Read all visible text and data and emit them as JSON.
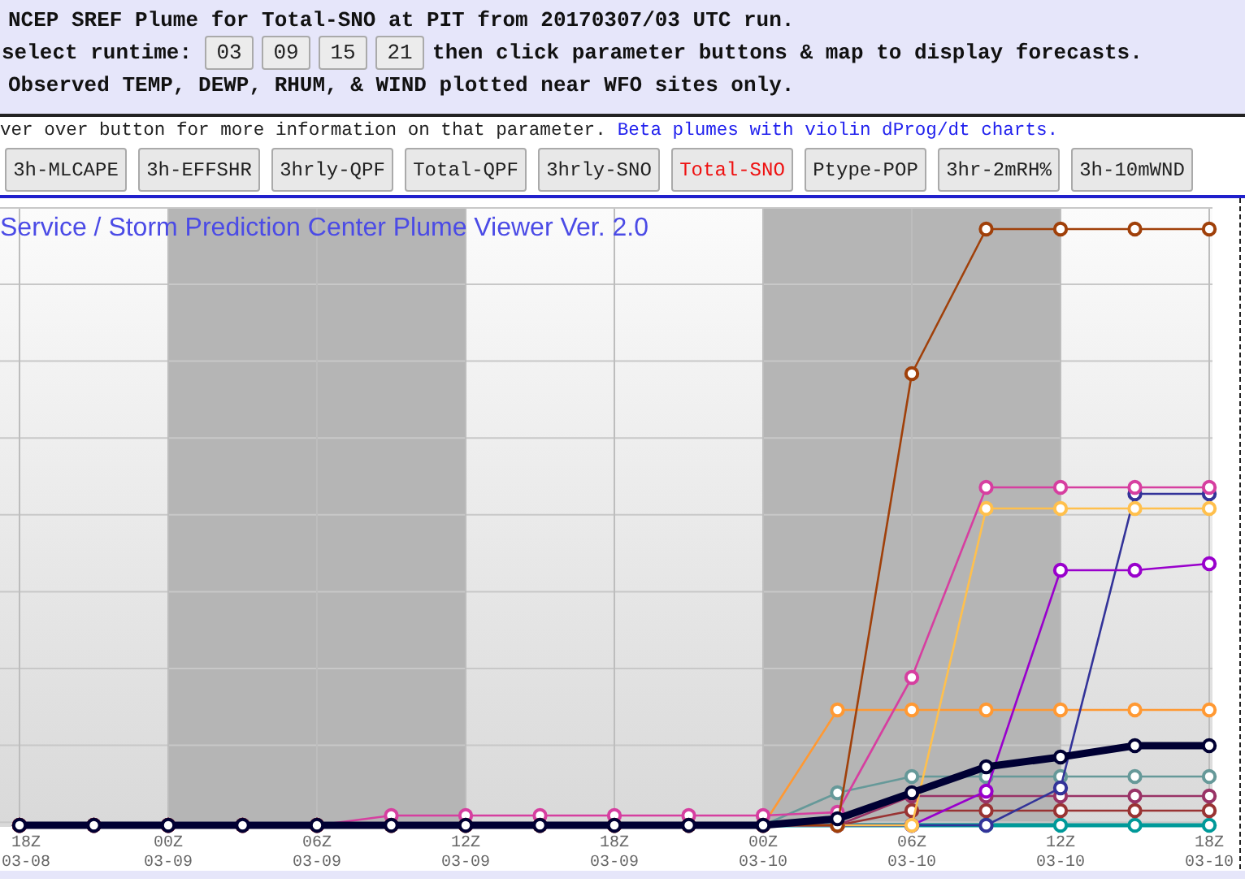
{
  "header": {
    "title": "NCEP SREF Plume for Total-SNO at PIT from 20170307/03 UTC run.",
    "runtime_label": "select runtime:",
    "runtimes": [
      "03",
      "09",
      "15",
      "21"
    ],
    "runtime_note": "then click parameter buttons & map to display forecasts.",
    "observed_note": "Observed TEMP, DEWP, RHUM, & WIND plotted near WFO sites only."
  },
  "hint": {
    "text": "ver over button for more information on that parameter.",
    "link": "Beta plumes with violin dProg/dt charts."
  },
  "parameter_buttons": [
    {
      "label": "3h-MLCAPE",
      "selected": false
    },
    {
      "label": "3h-EFFSHR",
      "selected": false
    },
    {
      "label": "3hrly-QPF",
      "selected": false
    },
    {
      "label": "Total-QPF",
      "selected": false
    },
    {
      "label": "3hrly-SNO",
      "selected": false
    },
    {
      "label": "Total-SNO",
      "selected": true
    },
    {
      "label": "Ptype-POP",
      "selected": false
    },
    {
      "label": "3hr-2mRH%",
      "selected": false
    },
    {
      "label": "3h-10mWND",
      "selected": false
    }
  ],
  "chart": {
    "title": "Service / Storm Prediction Center Plume Viewer Ver. 2.0",
    "x_labels": [
      {
        "time": "18Z",
        "date": "03-08"
      },
      {
        "time": "00Z",
        "date": "03-09"
      },
      {
        "time": "06Z",
        "date": "03-09"
      },
      {
        "time": "12Z",
        "date": "03-09"
      },
      {
        "time": "18Z",
        "date": "03-09"
      },
      {
        "time": "00Z",
        "date": "03-10"
      },
      {
        "time": "06Z",
        "date": "03-10"
      },
      {
        "time": "12Z",
        "date": "03-10"
      },
      {
        "time": "18Z",
        "date": "03-10"
      }
    ]
  }
}
